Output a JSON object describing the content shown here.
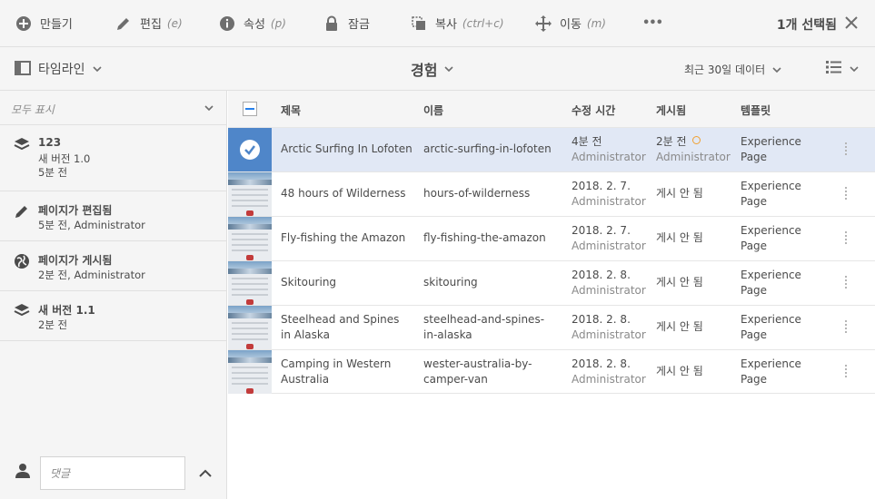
{
  "actionbar": {
    "create": "만들기",
    "edit": "편집",
    "edit_shortcut": "(e)",
    "properties": "속성",
    "properties_shortcut": "(p)",
    "lock": "잠금",
    "copy": "복사",
    "copy_shortcut": "(ctrl+c)",
    "move": "이동",
    "move_shortcut": "(m)",
    "more": "•••",
    "selection_count": "1개 선택됨"
  },
  "navbar": {
    "rail_toggle": "타임라인",
    "title": "경험",
    "filter": "최근 30일 데이터"
  },
  "rail": {
    "filter_label": "모두 표시",
    "items": [
      {
        "title": "123",
        "line1": "새 버전 1.0",
        "line2": "5분 전",
        "icon": "layers-icon"
      },
      {
        "title": "페이지가 편집됨",
        "line1": "5분 전, Administrator",
        "icon": "pencil-icon"
      },
      {
        "title": "페이지가 게시됨",
        "line1": "2분 전, Administrator",
        "icon": "globe-icon"
      },
      {
        "title": "새 버전 1.1",
        "line1": "2분 전",
        "icon": "layers-icon"
      }
    ],
    "comment_placeholder": "댓글"
  },
  "table": {
    "headers": {
      "title": "제목",
      "name": "이름",
      "modified": "수정 시간",
      "published": "게시됨",
      "template": "템플릿"
    },
    "rows": [
      {
        "title": "Arctic Surfing In Lofoten",
        "name": "arctic-surfing-in-lofoten",
        "modified": "4분 전",
        "modified_by": "Administrator",
        "published": "2분 전",
        "published_by": "Administrator",
        "template": "Experience Page",
        "selected": true
      },
      {
        "title": "48 hours of Wilderness",
        "name": "hours-of-wilderness",
        "modified": "2018. 2. 7.",
        "modified_by": "Administrator",
        "published": "게시 안 됨",
        "template": "Experience Page"
      },
      {
        "title": "Fly-fishing the Amazon",
        "name": "fly-fishing-the-amazon",
        "modified": "2018. 2. 7.",
        "modified_by": "Administrator",
        "published": "게시 안 됨",
        "template": "Experience Page"
      },
      {
        "title": "Skitouring",
        "name": "skitouring",
        "modified": "2018. 2. 8.",
        "modified_by": "Administrator",
        "published": "게시 안 됨",
        "template": "Experience Page"
      },
      {
        "title": "Steelhead and Spines in Alaska",
        "name": "steelhead-and-spines-in-alaska",
        "modified": "2018. 2. 8.",
        "modified_by": "Administrator",
        "published": "게시 안 됨",
        "template": "Experience Page"
      },
      {
        "title": "Camping in Western Australia",
        "name": "wester-australia-by-camper-van",
        "modified": "2018. 2. 8.",
        "modified_by": "Administrator",
        "published": "게시 안 됨",
        "template": "Experience Page"
      }
    ]
  },
  "colors": {
    "accent": "#2680eb",
    "selected_row": "#e1e8f5",
    "chrome": "#f5f5f5"
  }
}
